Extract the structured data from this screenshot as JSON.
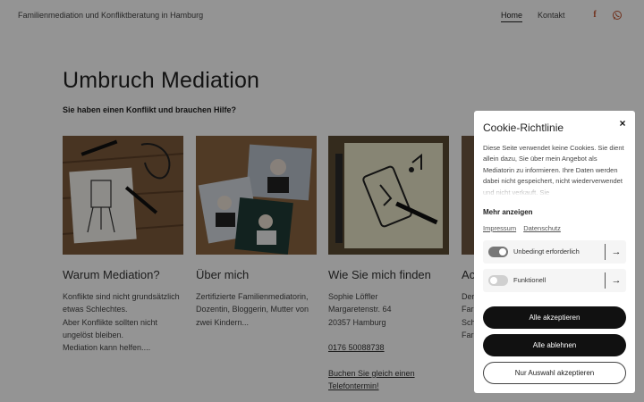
{
  "header": {
    "site_title": "Familienmediation und Konfliktberatung in Hamburg",
    "nav": {
      "home": "Home",
      "kontakt": "Kontakt"
    },
    "social": {
      "facebook": "facebook-icon",
      "whatsapp": "whatsapp-icon"
    }
  },
  "hero": {
    "title": "Umbruch Mediation",
    "subtitle": "Sie haben einen Konflikt und brauchen Hilfe?"
  },
  "cards": [
    {
      "title": "Warum Mediation?",
      "lines": [
        "Konflikte sind nicht grundsätzlich",
        "etwas Schlechtes.",
        "Aber Konflikte sollten nicht",
        "ungelöst bleiben.",
        "Mediation kann helfen...."
      ]
    },
    {
      "title": "Über mich",
      "lines": [
        "Zertifizierte Familienmediatorin,",
        "Dozentin, Bloggerin, Mutter von",
        "zwei Kindern..."
      ]
    },
    {
      "title": "Wie Sie mich finden",
      "lines": [
        "Sophie Löffler",
        "Margaretenstr. 64",
        "20357 Hamburg",
        "",
        "0176 50088738",
        "",
        "Buchen Sie gleich einen",
        "Telefontermin!"
      ]
    },
    {
      "title": "Ac",
      "lines": [
        "Der",
        "Far",
        "Sch",
        "Far"
      ]
    }
  ],
  "cookie": {
    "title": "Cookie-Richtlinie",
    "close": "×",
    "description": "Diese Seite verwendet keine Cookies. Sie dient allein dazu, Sie über mein Angebot als Mediatorin zu informieren. Ihre Daten werden dabei nicht gespeichert, nicht wiederverwendet und nicht verkauft. Sie",
    "more": "Mehr anzeigen",
    "links": {
      "impressum": "Impressum",
      "datenschutz": "Datenschutz"
    },
    "options": [
      {
        "label": "Unbedingt erforderlich",
        "enabled": true
      },
      {
        "label": "Funktionell",
        "enabled": false
      }
    ],
    "buttons": {
      "accept_all": "Alle akzeptieren",
      "reject_all": "Alle ablehnen",
      "accept_selection": "Nur Auswahl akzeptieren"
    }
  },
  "colors": {
    "accent": "#c0502c",
    "dark_button": "#111111",
    "toggle_on": "#777777",
    "toggle_off": "#d0d0d0"
  }
}
